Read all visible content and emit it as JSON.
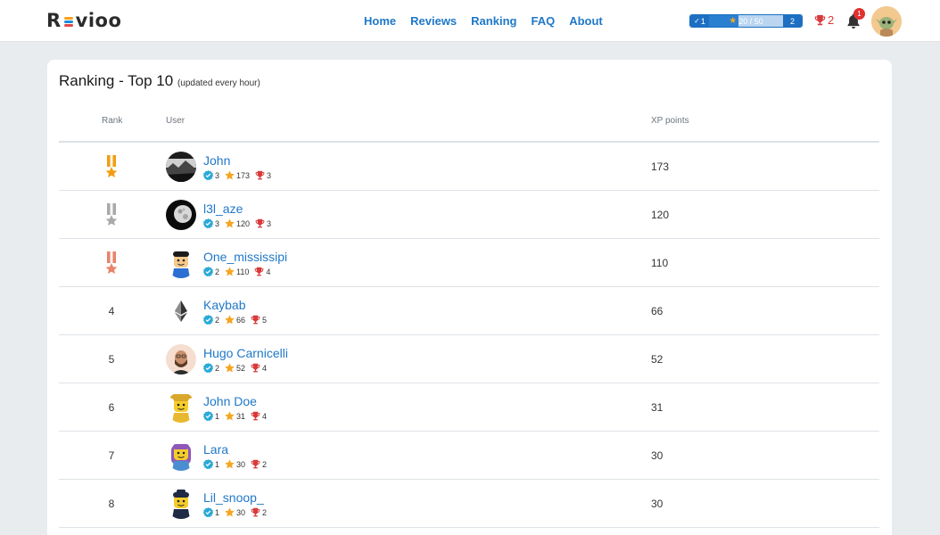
{
  "header": {
    "logo_text": [
      "R",
      "vioo"
    ],
    "nav": [
      "Home",
      "Reviews",
      "Ranking",
      "FAQ",
      "About"
    ],
    "xp": {
      "level": "1",
      "progress_text": "20 / 50",
      "progress_fraction": 0.4,
      "next_level": "2"
    },
    "trophies": "2",
    "notifications": "1"
  },
  "card": {
    "title": "Ranking - Top 10",
    "subtitle": "(updated every hour)"
  },
  "table": {
    "columns": {
      "rank": "Rank",
      "user": "User",
      "xp": "XP points"
    },
    "rows": [
      {
        "rank": "",
        "medal": "gold",
        "name": "John",
        "checks": "3",
        "stars": "173",
        "trophies": "3",
        "xp": "173",
        "avatar": "landscape"
      },
      {
        "rank": "",
        "medal": "silver",
        "name": "l3l_aze",
        "checks": "3",
        "stars": "120",
        "trophies": "3",
        "xp": "120",
        "avatar": "moon"
      },
      {
        "rank": "",
        "medal": "bronze",
        "name": "One_mississipi",
        "checks": "2",
        "stars": "110",
        "trophies": "4",
        "xp": "110",
        "avatar": "superman"
      },
      {
        "rank": "4",
        "medal": "",
        "name": "Kaybab",
        "checks": "2",
        "stars": "66",
        "trophies": "5",
        "xp": "66",
        "avatar": "ethereum"
      },
      {
        "rank": "5",
        "medal": "",
        "name": "Hugo Carnicelli",
        "checks": "2",
        "stars": "52",
        "trophies": "4",
        "xp": "52",
        "avatar": "bearded-man"
      },
      {
        "rank": "6",
        "medal": "",
        "name": "John Doe",
        "checks": "1",
        "stars": "31",
        "trophies": "4",
        "xp": "31",
        "avatar": "yellow-lego"
      },
      {
        "rank": "7",
        "medal": "",
        "name": "Lara",
        "checks": "1",
        "stars": "30",
        "trophies": "2",
        "xp": "30",
        "avatar": "purple-lego"
      },
      {
        "rank": "8",
        "medal": "",
        "name": "Lil_snoop_",
        "checks": "1",
        "stars": "30",
        "trophies": "2",
        "xp": "30",
        "avatar": "cap-lego"
      }
    ]
  },
  "colors": {
    "link": "#1f78c8",
    "gold": "#f29d12",
    "silver": "#a9a9a9",
    "bronze": "#e8826a",
    "verified": "#2aa9d6",
    "star": "#f5a623",
    "trophy": "#d83a3a",
    "xp_bar": "#1d6fc2"
  }
}
